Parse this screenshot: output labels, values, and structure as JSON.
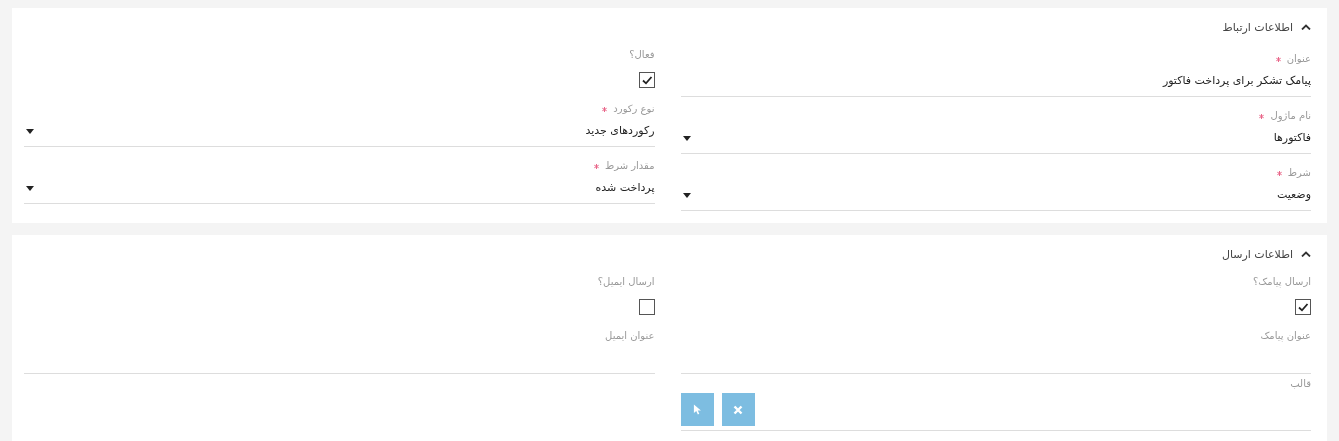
{
  "sections": [
    {
      "title": "اطلاعات ارتباط",
      "expanded": true,
      "columns": [
        [
          {
            "kind": "text",
            "label": "عنوان",
            "required": true,
            "value": "پیامک تشکر برای پرداخت فاکتور"
          },
          {
            "kind": "select",
            "label": "نام ماژول",
            "required": true,
            "value": "فاکتورها"
          },
          {
            "kind": "select",
            "label": "شرط",
            "required": true,
            "value": "وضعیت"
          }
        ],
        [
          {
            "kind": "checkbox",
            "label": "فعال؟",
            "required": false,
            "checked": true
          },
          {
            "kind": "select",
            "label": "نوع رکورد",
            "required": true,
            "value": "رکوردهای جدید"
          },
          {
            "kind": "select",
            "label": "مقدار شرط",
            "required": true,
            "value": "پرداخت شده"
          }
        ]
      ]
    },
    {
      "title": "اطلاعات ارسال",
      "expanded": true,
      "columns": [
        [
          {
            "kind": "checkbox",
            "label": "ارسال پیامک؟",
            "required": false,
            "checked": true
          },
          {
            "kind": "text",
            "label": "عنوان پیامک",
            "required": false
          },
          {
            "kind": "template",
            "label": "قالب",
            "required": false
          }
        ],
        [
          {
            "kind": "checkbox",
            "label": "ارسال ایمیل؟",
            "required": false,
            "checked": false
          },
          {
            "kind": "text",
            "label": "عنوان ایمیل",
            "required": false
          }
        ]
      ]
    }
  ]
}
